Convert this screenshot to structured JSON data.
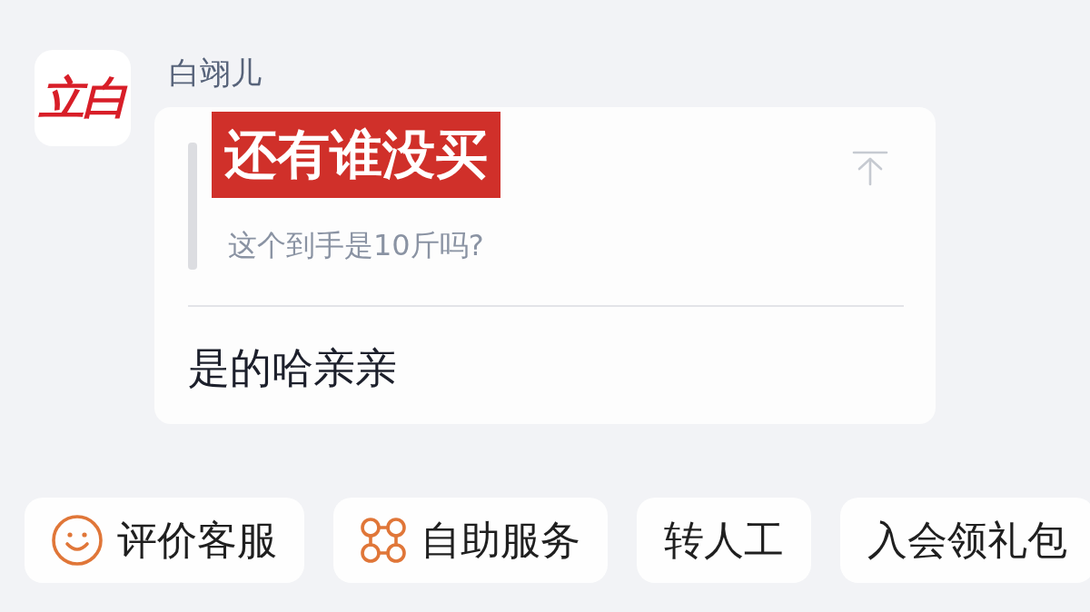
{
  "message": {
    "sender": {
      "name": "白翊儿",
      "avatar_logo": "立白"
    },
    "sticker": "还有谁没买",
    "quote": {
      "text": "这个到手是10斤吗?"
    },
    "reply": "是的哈亲亲"
  },
  "quick_actions": [
    {
      "label": "评价客服",
      "kind": "smiley"
    },
    {
      "label": "自助服务",
      "kind": "rings"
    },
    {
      "label": "转人工",
      "kind": "plain"
    },
    {
      "label": "入会领礼包",
      "kind": "plain"
    }
  ]
}
